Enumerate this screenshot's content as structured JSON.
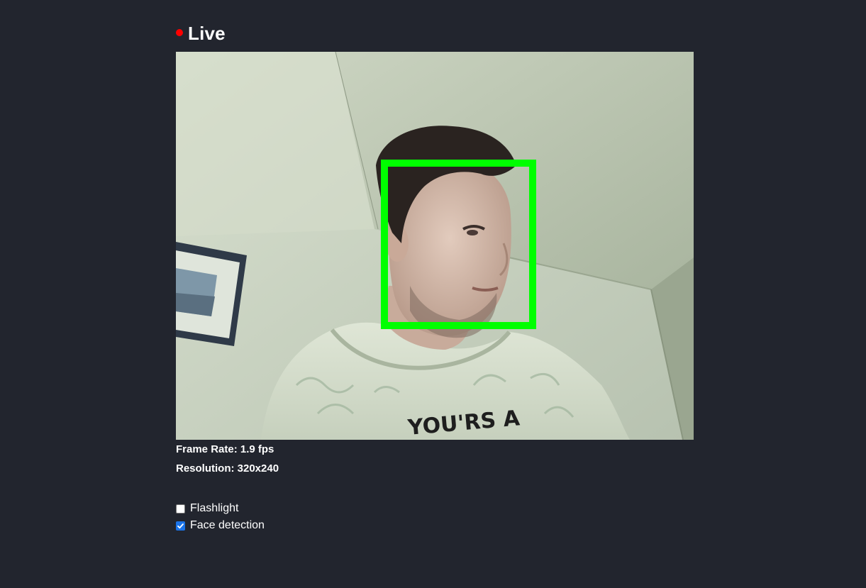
{
  "header": {
    "title": "Live",
    "status_color": "#ff0000"
  },
  "video": {
    "description_icon": "camera-feed",
    "detection_box_color": "#00ff00"
  },
  "stats": {
    "frame_rate": "Frame Rate: 1.9 fps",
    "resolution": "Resolution: 320x240"
  },
  "controls": {
    "flashlight": {
      "label": "Flashlight",
      "checked": false
    },
    "face_detection": {
      "label": "Face detection",
      "checked": true
    }
  },
  "colors": {
    "background": "#22252e",
    "accent": "#1a73e8"
  }
}
